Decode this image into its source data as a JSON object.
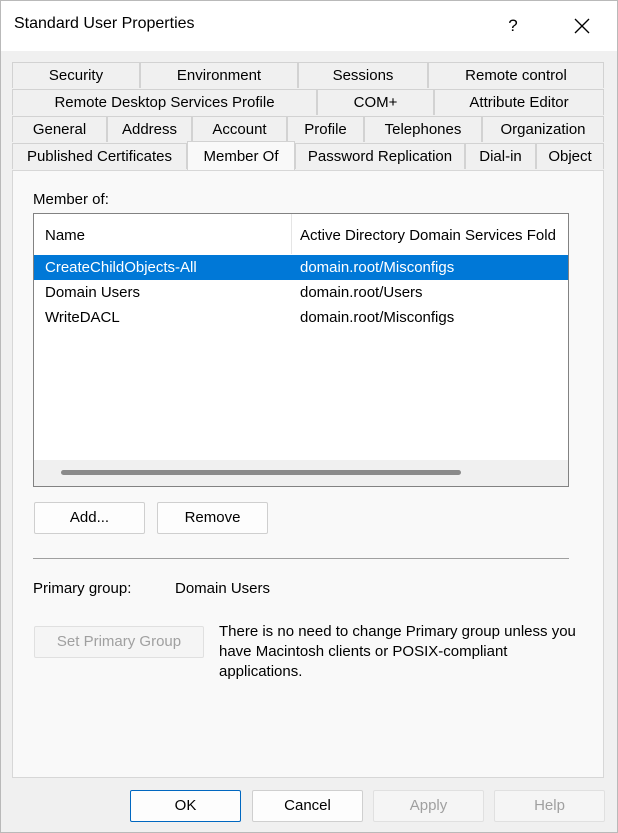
{
  "window": {
    "title": "Standard User Properties",
    "help": "?"
  },
  "tabs": {
    "row1": [
      "Security",
      "Environment",
      "Sessions",
      "Remote control"
    ],
    "row2": [
      "Remote Desktop Services Profile",
      "COM+",
      "Attribute Editor"
    ],
    "row3": [
      "General",
      "Address",
      "Account",
      "Profile",
      "Telephones",
      "Organization"
    ],
    "row4": [
      "Published Certificates",
      "Member Of",
      "Password Replication",
      "Dial-in",
      "Object"
    ],
    "active": "Member Of"
  },
  "member_of": {
    "label": "Member of:",
    "columns": [
      "Name",
      "Active Directory Domain Services Fold"
    ],
    "rows": [
      {
        "name": "CreateChildObjects-All",
        "folder": "domain.root/Misconfigs",
        "selected": true
      },
      {
        "name": "Domain Users",
        "folder": "domain.root/Users",
        "selected": false
      },
      {
        "name": "WriteDACL",
        "folder": "domain.root/Misconfigs",
        "selected": false
      }
    ]
  },
  "buttons": {
    "add": "Add...",
    "remove": "Remove",
    "set_primary": "Set Primary Group"
  },
  "primary_group": {
    "label": "Primary group:",
    "value": "Domain Users",
    "note": "There is no need to change Primary group unless you have Macintosh clients or POSIX-compliant applications."
  },
  "footer": {
    "ok": "OK",
    "cancel": "Cancel",
    "apply": "Apply",
    "help": "Help"
  },
  "colors": {
    "selection": "#0078d7",
    "accent": "#0067c0"
  }
}
